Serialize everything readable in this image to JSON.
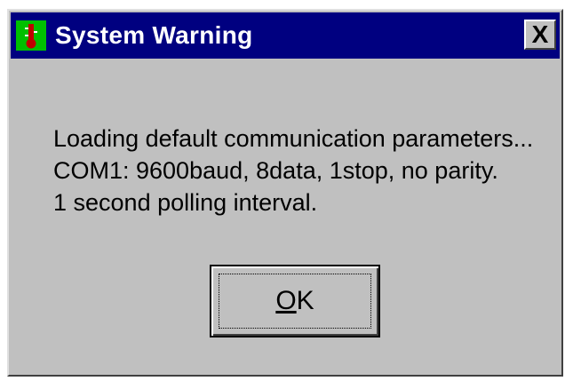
{
  "window": {
    "title": "System Warning",
    "icon": "thermometer-icon",
    "close_label": "X"
  },
  "message": {
    "lines": [
      "Loading default communication parameters...",
      "COM1: 9600baud, 8data, 1stop, no parity.",
      "1 second polling interval."
    ]
  },
  "buttons": {
    "ok_accel": "O",
    "ok_rest": "K"
  },
  "colors": {
    "titlebar": "#000080",
    "dialog_face": "#c0c0c0",
    "icon_background": "#00c000",
    "thermometer": "#c00000"
  }
}
